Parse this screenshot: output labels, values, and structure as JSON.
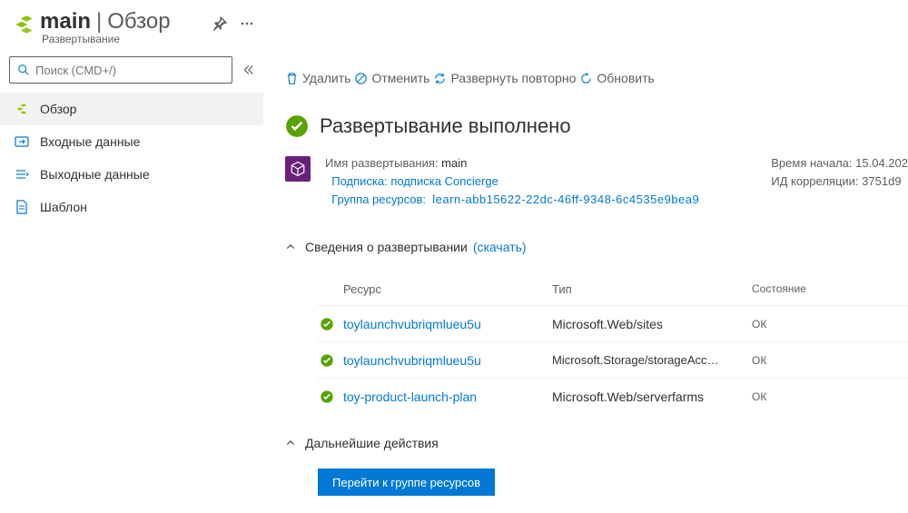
{
  "header": {
    "name": "main",
    "page": "Обзор",
    "subtitle": "Развертывание"
  },
  "search": {
    "placeholder": "Поиск (CMD+/)"
  },
  "sidebar": {
    "items": [
      {
        "label": "Обзор"
      },
      {
        "label": "Входные данные"
      },
      {
        "label": "Выходные данные"
      },
      {
        "label": "Шаблон"
      }
    ]
  },
  "toolbar": {
    "delete": "Удалить",
    "cancel": "Отменить",
    "redeploy": "Развернуть повторно",
    "refresh": "Обновить"
  },
  "status": {
    "title": "Развертывание выполнено"
  },
  "summary": {
    "deploy_label": "Имя развертывания:",
    "deploy_value": "main",
    "subscription_label": "Подписка:",
    "subscription_value": "подписка Concierge",
    "rg_label": "Группа ресурсов:",
    "rg_value": "learn-abb15622-22dc-46ff-9348-6c4535e9bea9",
    "start_time_label": "Время начала:",
    "start_time_value": "15.04.202",
    "correlation_label": "ИД корреляции:",
    "correlation_value": "3751d9"
  },
  "details": {
    "title": "Сведения о развертывании",
    "download": "(скачать)",
    "columns": {
      "resource": "Ресурс",
      "type": "Тип",
      "state": "Состояние"
    },
    "rows": [
      {
        "resource": "toylaunchvubriqmlueu5u",
        "type": "Microsoft.Web/sites",
        "state": "ОК"
      },
      {
        "resource": "toylaunchvubriqmlueu5u",
        "type": "Microsoft.Storage/storageAcc…",
        "state": "ОК"
      },
      {
        "resource": "toy-product-launch-plan",
        "type": "Microsoft.Web/serverfarms",
        "state": "ОК"
      }
    ]
  },
  "next_steps": {
    "title": "Дальнейшие действия",
    "button": "Перейти к группе ресурсов"
  }
}
